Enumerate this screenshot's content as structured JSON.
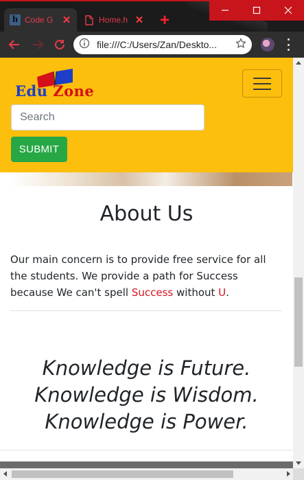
{
  "browser": {
    "tabs": [
      {
        "title": "Code G",
        "favicon": "h-icon",
        "active": true
      },
      {
        "title": "Home.h",
        "favicon": "document-icon",
        "active": false
      }
    ],
    "url": "file:///C:/Users/Zan/Deskto...",
    "colors": {
      "accent": "#c8141b",
      "tab_text": "#e8394d"
    }
  },
  "navbar": {
    "brand_edu": "Edu",
    "brand_zone": "Zone",
    "search_placeholder": "Search",
    "submit_label": "SUBMIT",
    "colors": {
      "background": "#fdbf0d",
      "submit": "#28a745"
    }
  },
  "about": {
    "title": "About Us",
    "text_part1": "Our main concern is to provide free service for all the students. We provide a path for Success because We can't spell ",
    "success_word": "Success",
    "text_part2": " without ",
    "u_letter": "U",
    "text_part3": "."
  },
  "quotes": [
    "Knowledge is Future.",
    "Knowledge is Wisdom.",
    "Knowledge is Power."
  ]
}
